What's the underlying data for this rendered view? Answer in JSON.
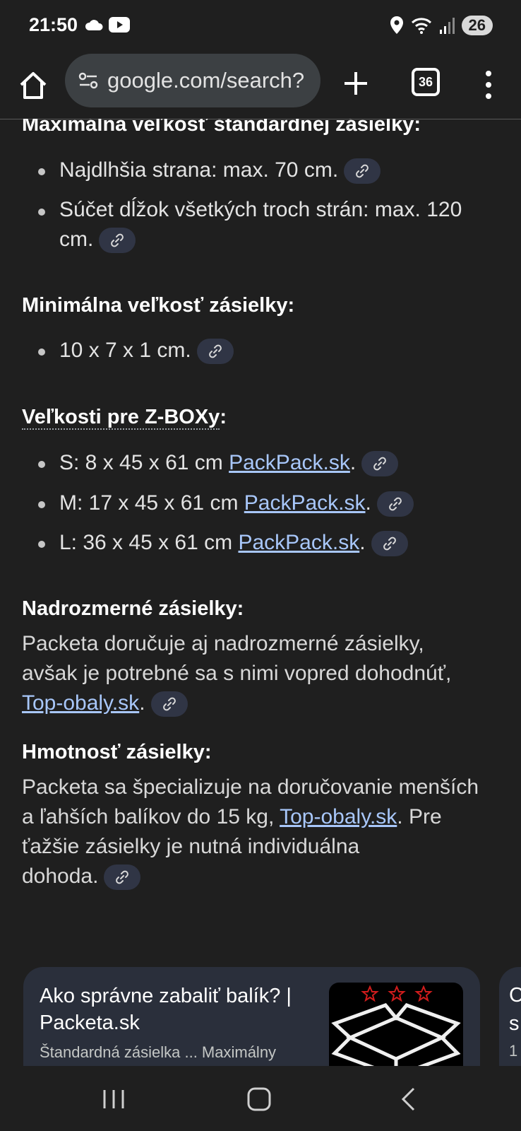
{
  "status": {
    "time": "21:50",
    "battery": "26"
  },
  "browser": {
    "url": "google.com/search?",
    "tab_count": "36"
  },
  "sections": {
    "max_heading": "Maximálna veľkosť štandardnej zásielky:",
    "max_items": [
      "Najdlhšia strana: max. 70 cm.",
      "Súčet dĺžok všetkých troch strán: max. 120",
      "cm."
    ],
    "min_heading": "Minimálna veľkosť zásielky:",
    "min_items": [
      "10 x 7 x 1 cm."
    ],
    "zbox_heading": "Veľkosti pre Z-BOXy",
    "zbox_colon": ":",
    "zbox_items": [
      {
        "text": "S: 8 x 45 x 61 cm ",
        "link": "PackPack.sk",
        "end": "."
      },
      {
        "text": "M: 17 x 45 x 61 cm ",
        "link": "PackPack.sk",
        "end": "."
      },
      {
        "text": "L: 36 x 45 x 61 cm ",
        "link": "PackPack.sk",
        "end": "."
      }
    ],
    "over_heading": "Nadrozmerné zásielky:",
    "over_lines": [
      "Packeta doručuje aj nadrozmerné zásielky,",
      "avšak je potrebné sa s nimi vopred dohodnúť,"
    ],
    "over_link": "Top-obaly.sk",
    "over_end": ".",
    "weight_heading": "Hmotnosť zásielky:",
    "weight_line1": "Packeta sa špecializuje na doručovanie menších",
    "weight_line2a": "a ľahších balíkov do 15 kg, ",
    "weight_link": "Top-obaly.sk",
    "weight_line2b": ". Pre",
    "weight_line3": "ťažšie zásielky je nutná individuálna",
    "weight_line4": "dohoda."
  },
  "card": {
    "title": "Ako správne zabaliť balík? | Packeta.sk",
    "snippet": "Štandardná zásielka ... Maximálny",
    "next_card_letters": [
      "C",
      "s",
      "1"
    ]
  },
  "colors": {
    "link": "#a8c7fa",
    "background": "#1f1f1f",
    "chip": "#303545"
  }
}
